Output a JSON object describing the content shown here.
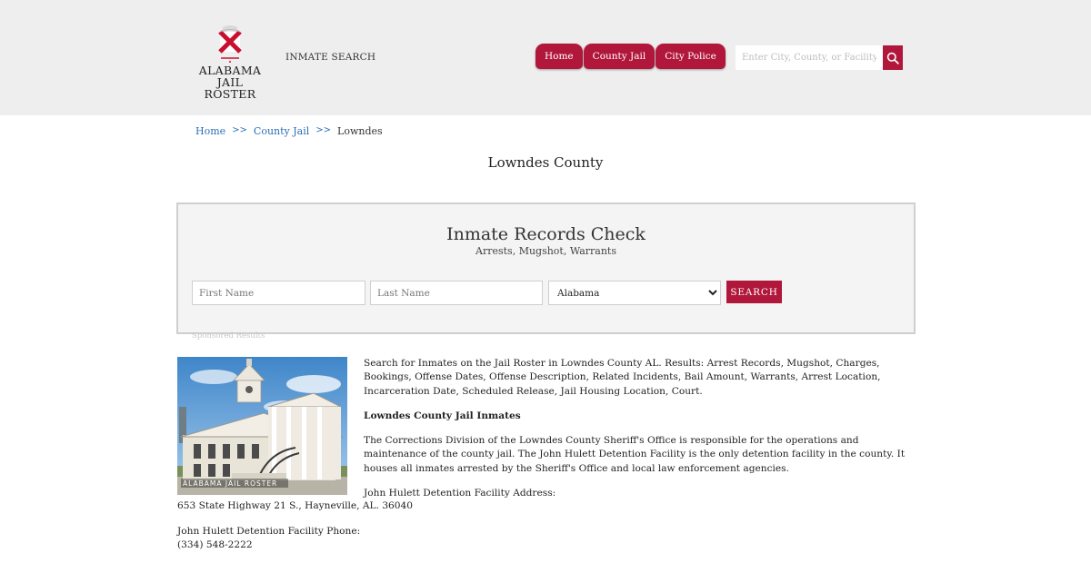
{
  "header": {
    "logo_line1": "ALABAMA",
    "logo_line2": "JAIL ROSTER",
    "inmate_search": "INMATE SEARCH",
    "nav": [
      "Home",
      "County Jail",
      "City Police"
    ],
    "search_placeholder": "Enter City, County, or Facility",
    "accent_color": "#b1173b"
  },
  "breadcrumb": {
    "home": "Home",
    "county_jail": "County Jail",
    "separator": ">>",
    "current": "Lowndes"
  },
  "page_title": "Lowndes County",
  "records_check": {
    "title": "Inmate Records Check",
    "subtitle": "Arrests, Mugshot, Warrants",
    "first_name_placeholder": "First Name",
    "last_name_placeholder": "Last Name",
    "state_selected": "Alabama",
    "search_button": "SEARCH"
  },
  "sponsored_label": "Sponsored Results",
  "photo_watermark": "ALABAMA JAIL ROSTER",
  "content": {
    "intro": "Search for Inmates on the Jail Roster in Lowndes County AL. Results: Arrest Records, Mugshot, Charges, Bookings, Offense Dates, Offense Description, Related Incidents, Bail Amount, Warrants, Arrest Location, Incarceration Date, Scheduled Release, Jail Housing Location, Court.",
    "jail_heading": "Lowndes County Jail Inmates",
    "description": "The Corrections Division of the Lowndes County Sheriff's Office is responsible for the operations and maintenance of the county jail. The John Hulett Detention Facility is the only detention facility in the county. It houses all inmates arrested by the Sheriff's Office and local law enforcement agencies.",
    "address_label": "John Hulett Detention Facility Address:",
    "address": "653 State Highway 21 S., Hayneville, AL. 36040",
    "phone_label": "John Hulett Detention Facility Phone:",
    "phone": "(334) 548-2222"
  }
}
